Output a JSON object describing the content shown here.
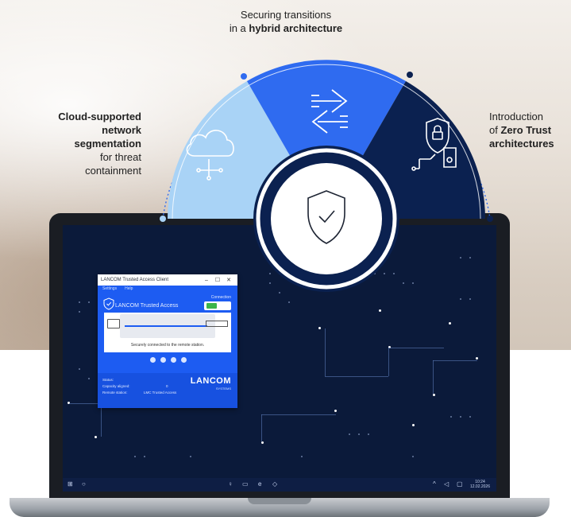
{
  "labels": {
    "top_line1": "Securing transitions",
    "top_line2_pre": "in a ",
    "top_line2_bold": "hybrid architecture",
    "left_bold1": "Cloud-supported",
    "left_bold2": "network",
    "left_bold3": "segmentation",
    "left_normal1": "for threat",
    "left_normal2": "containment",
    "right_line1": "Introduction",
    "right_pre": "of ",
    "right_bold1": "Zero Trust",
    "right_bold2": "architectures"
  },
  "segments": [
    {
      "name": "cloud-segment",
      "color": "#a9d3f6",
      "icon": "cloud-network-icon"
    },
    {
      "name": "transition-segment",
      "color": "#2f6bf0",
      "icon": "exchange-arrows-icon"
    },
    {
      "name": "zero-trust-segment",
      "color": "#0b2150",
      "icon": "lock-certificate-icon"
    }
  ],
  "center_icon": "shield-check-icon",
  "client": {
    "title": "LANCOM Trusted Access Client",
    "menu": [
      "Settings",
      "Help"
    ],
    "brand": "LANCOM Trusted Access",
    "connection_label": "Connection",
    "status_message": "Securely connected to the remote station.",
    "footer_rows": [
      {
        "label": "Status:",
        "value": ""
      },
      {
        "label": "Capacity aligned:",
        "value": "0"
      },
      {
        "label": "Remote station:",
        "value": "LMC Trusted Access"
      }
    ],
    "logo": "LANCOM",
    "logo_sub": "SYSTEMS"
  },
  "taskbar": {
    "time": "10:24",
    "date": "12.02.2026"
  },
  "colors": {
    "light_blue": "#a9d3f6",
    "mid_blue": "#2f6bf0",
    "dark_navy": "#0b2150",
    "screen_bg": "#0b1a3a"
  }
}
